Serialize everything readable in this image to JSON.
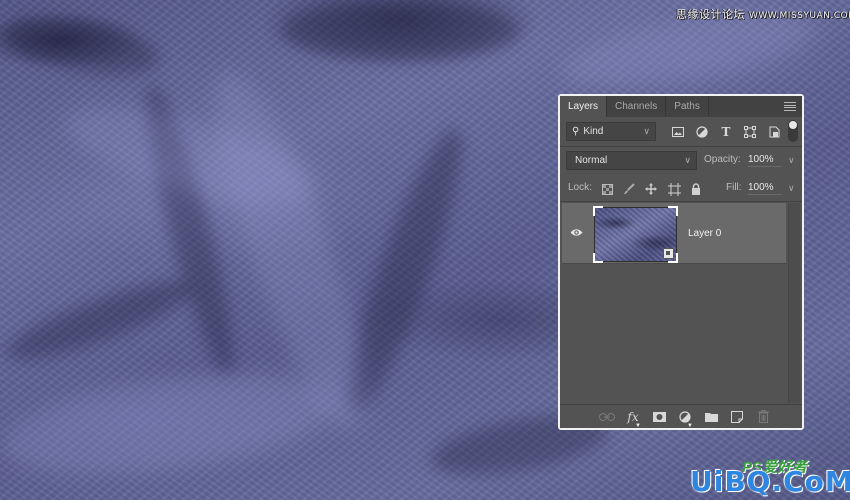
{
  "background": {
    "description": "purple-blue terry towel fabric texture",
    "accent_color": "#5d6290"
  },
  "watermarks": {
    "top_cn": "思缘设计论坛",
    "top_url": "WWW.MISSYUAN.COM",
    "bottom_ps": "PS爱好者",
    "bottom_brand": "UiBQ.CoM"
  },
  "panel": {
    "tabs": [
      {
        "label": "Layers",
        "active": true
      },
      {
        "label": "Channels",
        "active": false
      },
      {
        "label": "Paths",
        "active": false
      }
    ],
    "menu_icon": "hamburger-menu-icon",
    "filter": {
      "kind_label": "Kind",
      "search_icon": "search-icon",
      "filter_icons": [
        "image-filter-icon",
        "adjustment-filter-icon",
        "type-filter-icon",
        "shape-filter-icon",
        "smart-object-filter-icon"
      ],
      "toggle_on": true
    },
    "blend_mode": "Normal",
    "opacity_label": "Opacity:",
    "opacity_value": "100%",
    "lock_label": "Lock:",
    "lock_icons": [
      "lock-transparent-pixels-icon",
      "lock-image-pixels-icon",
      "lock-position-icon",
      "lock-artboard-icon",
      "lock-all-icon"
    ],
    "fill_label": "Fill:",
    "fill_value": "100%",
    "layers": [
      {
        "name": "Layer 0",
        "visible": true,
        "smart_object": true,
        "selected": true
      }
    ],
    "bottom_buttons": [
      {
        "name": "link-layers",
        "icon": "link-icon",
        "glyph": "⊖",
        "enabled": false
      },
      {
        "name": "add-layer-style",
        "icon": "fx-icon",
        "glyph": "fx",
        "enabled": true
      },
      {
        "name": "add-mask",
        "icon": "mask-icon",
        "glyph": "◘",
        "enabled": true
      },
      {
        "name": "new-adjustment-layer",
        "icon": "adjustment-icon",
        "glyph": "◐",
        "enabled": true
      },
      {
        "name": "new-group",
        "icon": "folder-icon",
        "glyph": "▬",
        "enabled": true
      },
      {
        "name": "new-layer",
        "icon": "new-layer-icon",
        "glyph": "◻",
        "enabled": true
      },
      {
        "name": "delete-layer",
        "icon": "trash-icon",
        "glyph": "🗑",
        "enabled": false
      }
    ]
  }
}
